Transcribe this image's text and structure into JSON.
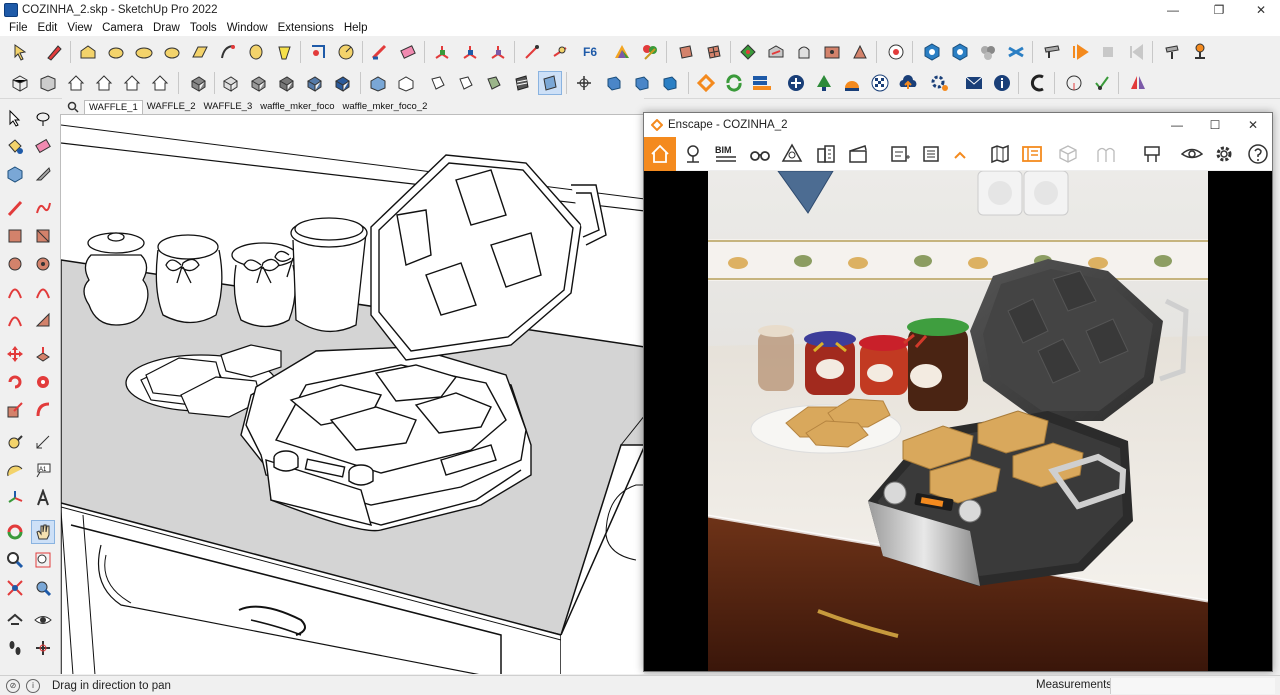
{
  "window": {
    "title": "COZINHA_2.skp - SketchUp Pro 2022",
    "minimize": "—",
    "maximize": "❐",
    "close": "✕"
  },
  "menu": [
    "File",
    "Edit",
    "View",
    "Camera",
    "Draw",
    "Tools",
    "Window",
    "Extensions",
    "Help"
  ],
  "scenes": {
    "tabs": [
      "WAFFLE_1",
      "WAFFLE_2",
      "WAFFLE_3",
      "waffle_mker_foco",
      "waffle_mker_foco_2"
    ],
    "active": 0
  },
  "status": {
    "hint": "Drag in direction to pan",
    "measurements_label": "Measurements",
    "measurements_value": ""
  },
  "enscape": {
    "title": "Enscape - COZINHA_2",
    "bim_label": "BIM",
    "minimize": "—",
    "maximize": "☐",
    "close": "✕"
  },
  "colors": {
    "enscape_accent": "#f48a1e",
    "sketchup_blue": "#1e5aa8"
  }
}
